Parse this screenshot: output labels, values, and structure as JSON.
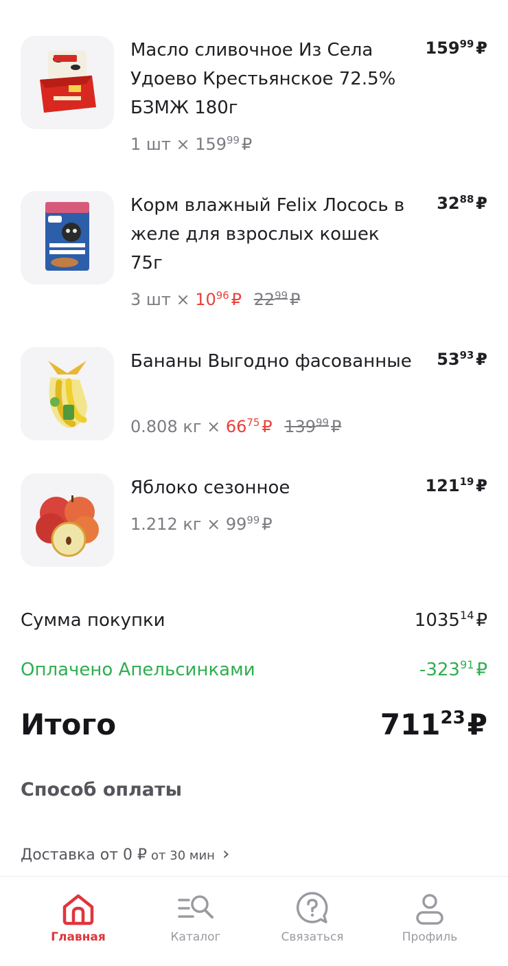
{
  "items": [
    {
      "name": "Масло сливочное Из Села Удоево Крестьянское 72.5% БЗМЖ 180г",
      "total_int": "159",
      "total_frac": "99",
      "currency": "₽",
      "qty": "1 шт ×",
      "unit_int": "159",
      "unit_frac": "99",
      "image": "butter-pack-icon"
    },
    {
      "name": "Корм влажный Felix Лосось в желе для взрослых кошек 75г",
      "total_int": "32",
      "total_frac": "88",
      "currency": "₽",
      "qty": "3 шт ×",
      "unit_int": "10",
      "unit_frac": "96",
      "old_int": "22",
      "old_frac": "99",
      "image": "cat-food-pouch-icon"
    },
    {
      "name": "Бананы Выгодно фасованные",
      "total_int": "53",
      "total_frac": "93",
      "currency": "₽",
      "qty": "0.808 кг ×",
      "unit_int": "66",
      "unit_frac": "75",
      "old_int": "139",
      "old_frac": "99",
      "image": "bananas-icon"
    },
    {
      "name": "Яблоко сезонное",
      "total_int": "121",
      "total_frac": "19",
      "currency": "₽",
      "qty": "1.212 кг ×",
      "unit_int": "99",
      "unit_frac": "99",
      "image": "apples-icon"
    }
  ],
  "summary": {
    "purchase_label": "Сумма покупки",
    "purchase_int": "1035",
    "purchase_frac": "14",
    "bonus_label": "Оплачено Апельсинками",
    "bonus_int": "-323",
    "bonus_frac": "91",
    "total_label": "Итого",
    "total_int": "711",
    "total_frac": "23",
    "currency": "₽"
  },
  "payment": {
    "title": "Способ оплаты"
  },
  "delivery": {
    "text": "Доставка от 0 ₽",
    "time": "от 30 мин",
    "chevron": "›"
  },
  "tabbar": [
    {
      "label": "Главная",
      "icon": "home-icon",
      "active": true
    },
    {
      "label": "Каталог",
      "icon": "catalog-search-icon",
      "active": false
    },
    {
      "label": "Связаться",
      "icon": "help-chat-icon",
      "active": false
    },
    {
      "label": "Профиль",
      "icon": "profile-icon",
      "active": false
    }
  ],
  "colors": {
    "accent": "#e0353b",
    "sale": "#e8413a",
    "bonus": "#2fae4f",
    "muted": "#7b7b82"
  }
}
